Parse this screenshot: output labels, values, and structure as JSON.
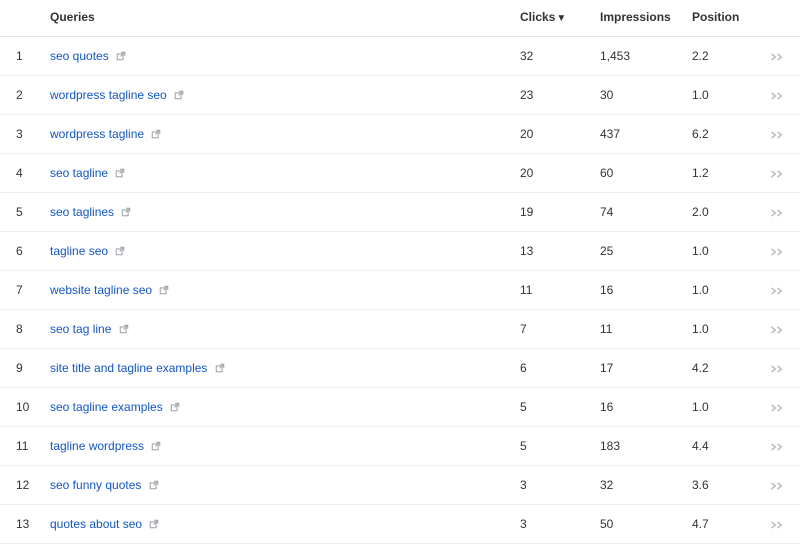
{
  "table": {
    "headers": {
      "queries": "Queries",
      "clicks": "Clicks",
      "clicks_sort_indicator": "▼",
      "impressions": "Impressions",
      "position": "Position"
    },
    "rows": [
      {
        "num": "1",
        "query": "seo quotes",
        "clicks": "32",
        "impressions": "1,453",
        "position": "2.2"
      },
      {
        "num": "2",
        "query": "wordpress tagline seo",
        "clicks": "23",
        "impressions": "30",
        "position": "1.0"
      },
      {
        "num": "3",
        "query": "wordpress tagline",
        "clicks": "20",
        "impressions": "437",
        "position": "6.2"
      },
      {
        "num": "4",
        "query": "seo tagline",
        "clicks": "20",
        "impressions": "60",
        "position": "1.2"
      },
      {
        "num": "5",
        "query": "seo taglines",
        "clicks": "19",
        "impressions": "74",
        "position": "2.0"
      },
      {
        "num": "6",
        "query": "tagline seo",
        "clicks": "13",
        "impressions": "25",
        "position": "1.0"
      },
      {
        "num": "7",
        "query": "website tagline seo",
        "clicks": "11",
        "impressions": "16",
        "position": "1.0"
      },
      {
        "num": "8",
        "query": "seo tag line",
        "clicks": "7",
        "impressions": "11",
        "position": "1.0"
      },
      {
        "num": "9",
        "query": "site title and tagline examples",
        "clicks": "6",
        "impressions": "17",
        "position": "4.2"
      },
      {
        "num": "10",
        "query": "seo tagline examples",
        "clicks": "5",
        "impressions": "16",
        "position": "1.0"
      },
      {
        "num": "11",
        "query": "tagline wordpress",
        "clicks": "5",
        "impressions": "183",
        "position": "4.4"
      },
      {
        "num": "12",
        "query": "seo funny quotes",
        "clicks": "3",
        "impressions": "32",
        "position": "3.6"
      },
      {
        "num": "13",
        "query": "quotes about seo",
        "clicks": "3",
        "impressions": "50",
        "position": "4.7"
      }
    ]
  }
}
